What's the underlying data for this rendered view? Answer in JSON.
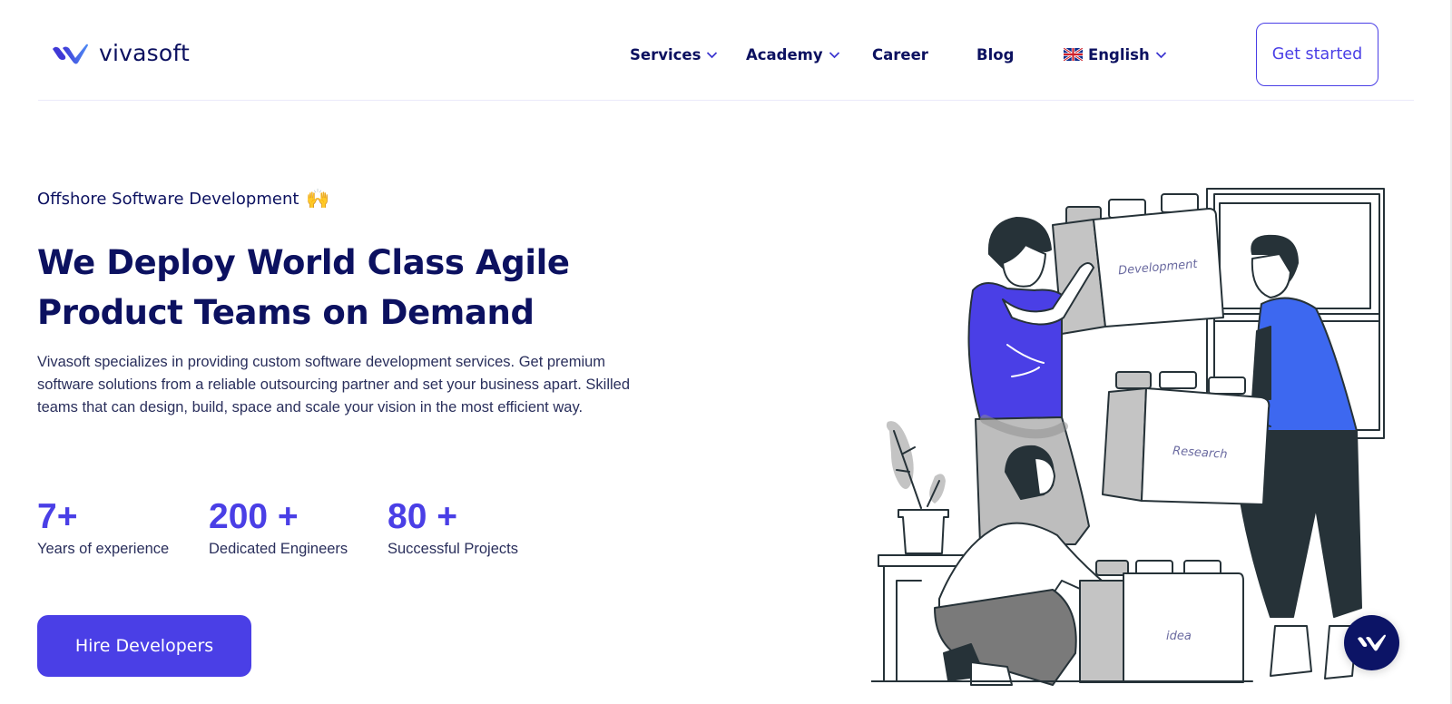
{
  "brand": {
    "name": "vivasoft",
    "logo_icon": "vivasoft-logo-mark",
    "colors": {
      "primary": "#4a3fe6",
      "navy": "#0c1160",
      "logo_gradient_start": "#3f38d6",
      "logo_gradient_end": "#4f8cf5",
      "chat_widget": "#0c1466"
    }
  },
  "nav": {
    "items": [
      {
        "label": "Services",
        "has_dropdown": true,
        "icon": "chevron-down-icon"
      },
      {
        "label": "Academy",
        "has_dropdown": true,
        "icon": "chevron-down-icon"
      },
      {
        "label": "Career",
        "has_dropdown": false
      },
      {
        "label": "Blog",
        "has_dropdown": false
      }
    ],
    "language": {
      "label": "English",
      "flag": "uk-flag-icon",
      "has_dropdown": true
    },
    "cta_label": "Get started"
  },
  "hero": {
    "eyebrow": "Offshore Software Development",
    "eyebrow_emoji": "🙌",
    "headline_line1": "We Deploy World Class Agile",
    "headline_line2": "Product Teams on Demand",
    "description": "Vivasoft specializes in providing custom software development services. Get premium software solutions from a reliable outsourcing partner and set your business apart. Skilled teams that can design, build, space and scale your vision in the most efficient way.",
    "stats": [
      {
        "value": "7+",
        "label": "Years of experience"
      },
      {
        "value": "200 +",
        "label": "Dedicated Engineers"
      },
      {
        "value": "80 +",
        "label": "Successful Projects"
      }
    ],
    "cta_label": "Hire Developers"
  },
  "illustration": {
    "description": "team-carrying-boxes-illustration",
    "box_labels": [
      "Development",
      "Research",
      "idea"
    ]
  },
  "chat_widget": {
    "icon": "vivasoft-chat-icon"
  }
}
